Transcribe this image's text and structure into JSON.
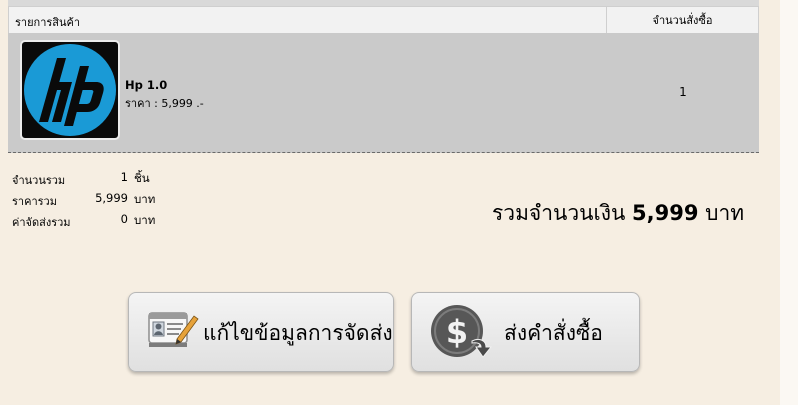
{
  "table": {
    "header_product": "รายการสินค้า",
    "header_qty": "จำนวนสั่งซื้อ",
    "items": [
      {
        "name": "Hp 1.0",
        "price": "ราคา : 5,999 .-",
        "qty": "1",
        "logo_text": "hp",
        "logo_color": "#1a9ad6"
      }
    ]
  },
  "summary": {
    "qty_label": "จำนวนรวม",
    "qty_value": "1",
    "qty_unit": "ชิ้น",
    "price_label": "ราคารวม",
    "price_value": "5,999",
    "price_unit": "บาท",
    "shipping_label": "ค่าจัดส่งรวม",
    "shipping_value": "0",
    "shipping_unit": "บาท"
  },
  "grand_total": {
    "prefix": "รวมจำนวนเงิน",
    "amount": "5,999",
    "unit": "บาท"
  },
  "buttons": {
    "edit_label": "แก้ไขข้อมูลการจัดส่ง",
    "edit_icon": "id-card-edit-icon",
    "order_label": "ส่งคำสั่งซื้อ",
    "order_icon": "dollar-arrow-icon"
  }
}
